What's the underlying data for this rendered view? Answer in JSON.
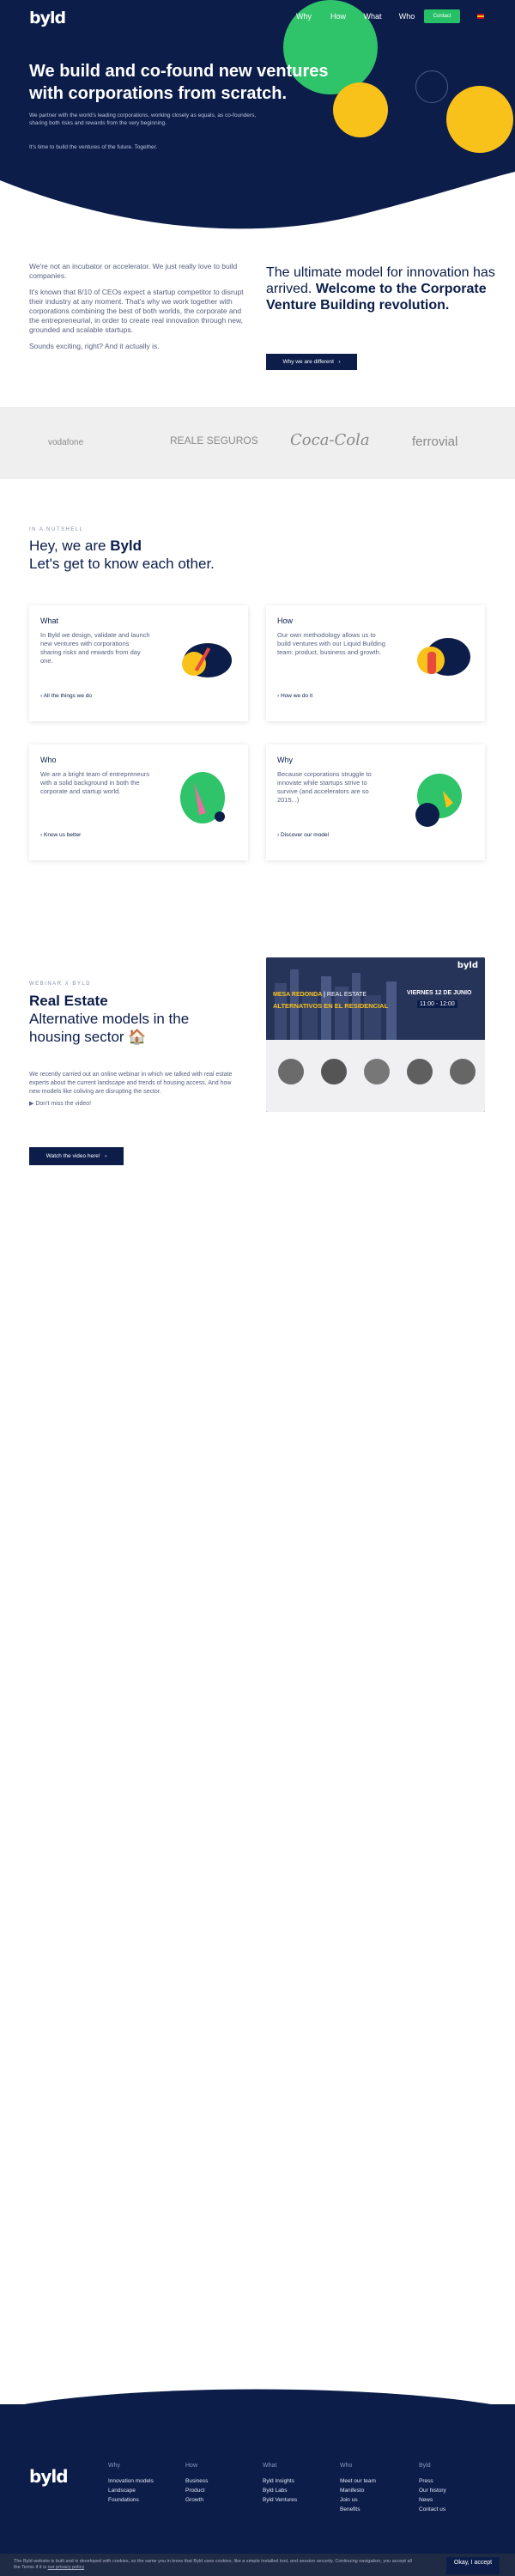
{
  "header": {
    "logo": "byld",
    "nav": [
      "Why",
      "How",
      "What",
      "Who"
    ],
    "contact_label": "Contact"
  },
  "hero": {
    "title_line1": "We build and co-found new ventures",
    "title_line2": "with corporations from scratch.",
    "subtitle": "We partner with the world's leading corporations, working closely as equals, as co-founders, sharing both risks and rewards from the very beginning.",
    "subtitle2": "It's time to build the ventures of the future. Together."
  },
  "intro": {
    "p1": "We're not an incubator or accelerator. We just really love to build companies.",
    "p2": "It's known that 8/10 of CEOs expect a startup competitor to disrupt their industry at any moment. That's why we work together with corporations combining the best of both worlds, the corporate and the entrepreneurial, in order to create real innovation through new, grounded and scalable startups.",
    "p3": "Sounds exciting, right? And it actually is.",
    "headline_normal": "The ultimate model for innovation has arrived.",
    "headline_bold": "Welcome to the Corporate Venture Building revolution.",
    "button_label": "Why we are different"
  },
  "partners": [
    "vodafone",
    "REALE SEGUROS",
    "Coca-Cola",
    "ferrovial"
  ],
  "about": {
    "eyebrow": "IN A NUTSHELL",
    "title_line1_prefix": "Hey, we are",
    "title_line1_brand": "Byld",
    "title_line2": "Let's get to know each other.",
    "cards": [
      {
        "title": "What",
        "text": "In Byld we design, validate and launch new ventures with corporations sharing risks and rewards from day one.",
        "link": "All the things we do"
      },
      {
        "title": "How",
        "text": "Our own methodology allows us to build ventures with our Liquid Building team: product, business and growth.",
        "link": "How we do it"
      },
      {
        "title": "Who",
        "text": "We are a bright team of entrepreneurs with a solid background in both the corporate and startup world.",
        "link": "Know us better"
      },
      {
        "title": "Why",
        "text": "Because corporations struggle to innovate while startups strive to survive (and accelerators are so 2015...)",
        "link": "Discover our model"
      }
    ]
  },
  "webinar": {
    "eyebrow": "WEBINAR X BYLD",
    "title_bold": "Real Estate",
    "title_rest": "Alternative models in the housing sector 🏠",
    "text": "We recently carried out an online webinar in which we talked with real estate experts about the current landscape and trends of housing access. And how new models like coliving are disrupting the sector.",
    "note": "Don't miss the video!",
    "button_label": "Watch the video here!",
    "image": {
      "logo": "byld",
      "tag": "MESA REDONDA",
      "tag_rest": "REAL ESTATE",
      "headline": "ALTERNATIVOS EN EL RESIDENCIAL",
      "date": "VIERNES 12 DE JUNIO",
      "time": "11:00 - 12:00"
    }
  },
  "footer": {
    "logo": "byld",
    "columns": [
      {
        "title": "Why",
        "links": [
          "Innovation models",
          "Landscape",
          "Foundations"
        ]
      },
      {
        "title": "How",
        "links": [
          "Business",
          "Product",
          "Growth"
        ]
      },
      {
        "title": "What",
        "links": [
          "Byld Insights",
          "Byld Labs",
          "Byld Ventures"
        ]
      },
      {
        "title": "Who",
        "links": [
          "Meet our team",
          "Manifesto",
          "Join us",
          "Benefits"
        ]
      },
      {
        "title": "Byld",
        "links": [
          "Press",
          "Our history",
          "News",
          "Contact us"
        ]
      }
    ]
  },
  "cookie": {
    "text": "The Byld website is built and is developed with cookies, so the same you in know that Byld uses cookies, like a simple installed tool, and session security. Continuing navigation, you accept all the Terms if it is",
    "link": "our privacy policy",
    "button_label": "Okay, I accept"
  },
  "colors": {
    "navy": "#0c1d4a",
    "green": "#2fc36a",
    "yellow": "#f9c21a"
  }
}
